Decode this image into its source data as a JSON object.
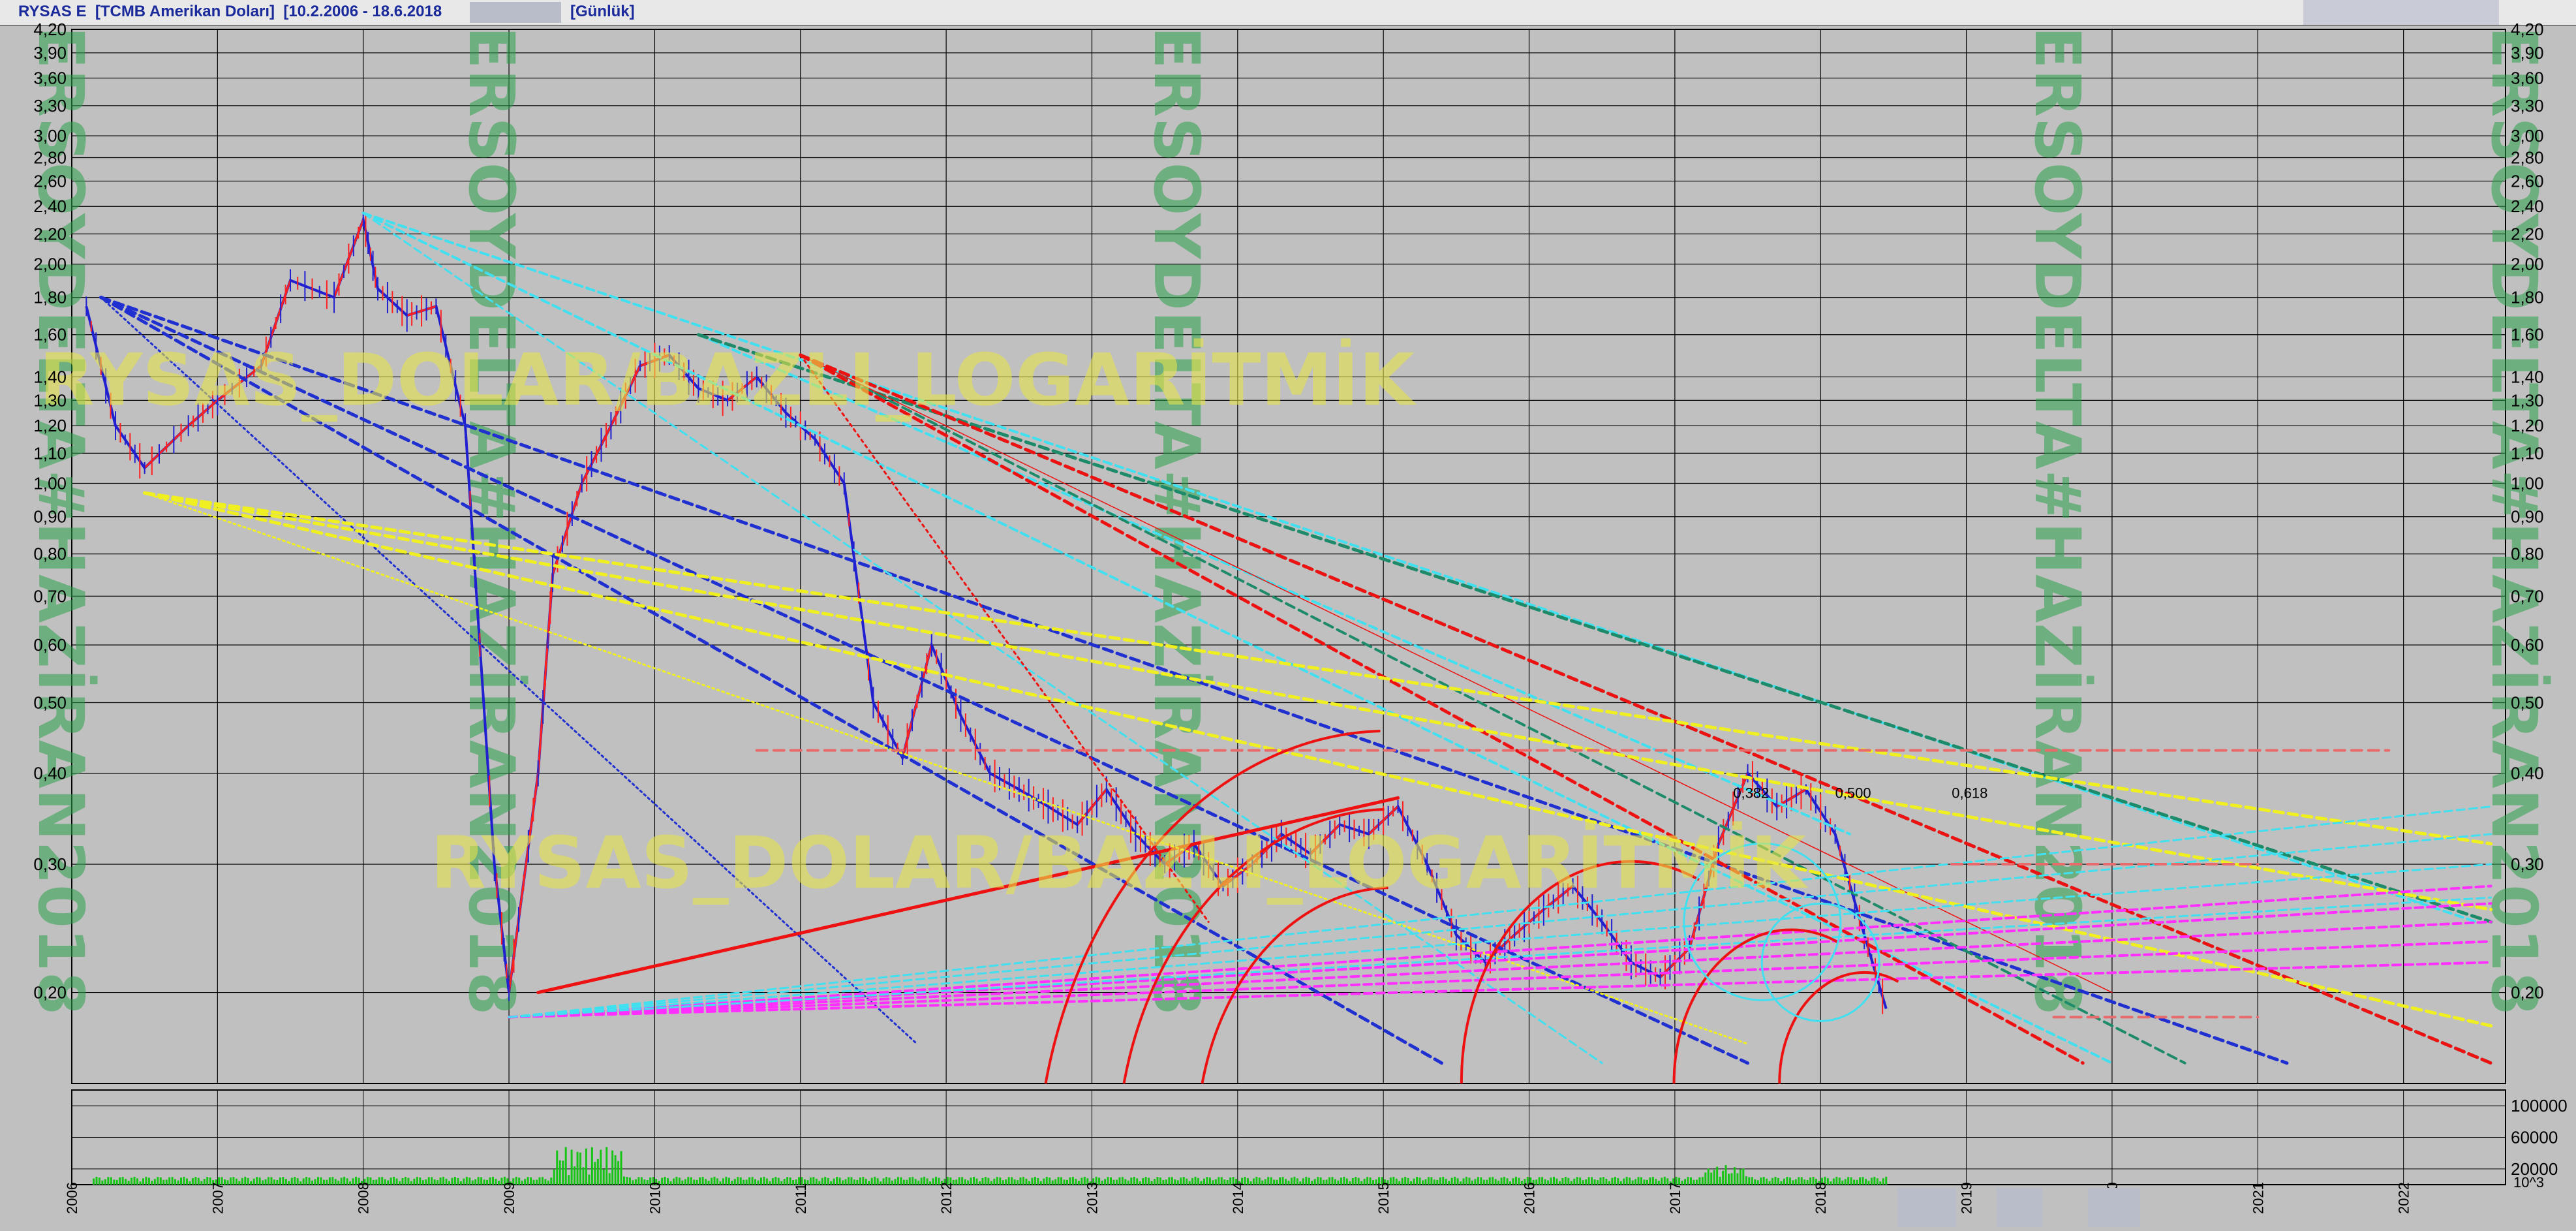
{
  "header": {
    "symbol": "RYSAS E",
    "currency": "[TCMB Amerikan Doları]",
    "range": "[10.2.2006 - 18.6.2018",
    "period": "[Günlük]"
  },
  "watermarks": {
    "vertical": [
      "ERSOYDELTA#HAZİRAN2018",
      "ERSOYDELTA#HAZİRAN2018",
      "ERSOYDELTA#HAZİRAN2018",
      "ERSOYDELTA#HAZİRAN2018",
      "ERSOYDELTA#HAZİRAN2018"
    ],
    "horizontal_top": "RYSAS_DOLAR/BAZLI_LOGARİTMİK",
    "horizontal_mid": "RYSAS_DOLAR/BAZLI_LOGARİTMİK"
  },
  "fib_labels": [
    "0,382",
    "0,500",
    "0,618"
  ],
  "volume_scale_note": "10^3",
  "colors": {
    "background": "#c0c0c0",
    "price_up": "#ff2020",
    "price_down": "#2020d0",
    "volume": "#16c416",
    "trend_blue": "#1f2fd0",
    "trend_cyan": "#40e0f0",
    "trend_yellow": "#f0f020",
    "trend_red": "#ee1111",
    "trend_teal": "#1d8a6a",
    "trend_magenta": "#ff30ff",
    "watermark": "#2aa04a",
    "watermark_h": "#e6e24a"
  },
  "chart_data": {
    "type": "line",
    "title": "RYSAS E [TCMB Amerikan Doları] [10.2.2006 - 18.6.2018 [Günlük]",
    "y_scale": "log",
    "ylim": [
      0.15,
      4.2
    ],
    "xlim": [
      2006.0,
      2022.7
    ],
    "price_y_ticks": [
      "4,20",
      "3,90",
      "3,60",
      "3,30",
      "3,00",
      "2,80",
      "2,60",
      "2,40",
      "2,20",
      "2,00",
      "1,80",
      "1,60",
      "1,40",
      "1,30",
      "1,20",
      "1,10",
      "1,00",
      "0,90",
      "0,80",
      "0,70",
      "0,60",
      "0,50",
      "0,40",
      "0,30",
      "0,20"
    ],
    "volume_y_ticks": [
      "100000",
      "60000",
      "20000"
    ],
    "x_tick_labels": [
      "2006",
      "2007",
      "2008",
      "2009",
      "2010",
      "2011",
      "2012",
      "2013",
      "2014",
      "2015",
      "2016",
      "2017",
      "2018",
      "2019",
      "2020",
      "2021",
      "2022"
    ],
    "grid": true,
    "series": [
      {
        "x": [
          2006.1,
          2006.3,
          2006.5,
          2006.8,
          2007.0,
          2007.3,
          2007.5,
          2007.8,
          2008.0,
          2008.1,
          2008.3,
          2008.5,
          2008.7,
          2008.9,
          2009.0,
          2009.2,
          2009.3,
          2009.5,
          2009.7,
          2009.9,
          2010.1,
          2010.3,
          2010.5,
          2010.7,
          2010.9,
          2011.1,
          2011.3,
          2011.5,
          2011.7,
          2011.9,
          2012.1,
          2012.3,
          2012.5,
          2012.7,
          2012.9,
          2013.1,
          2013.3,
          2013.5,
          2013.7,
          2013.9,
          2014.1,
          2014.3,
          2014.5,
          2014.7,
          2014.9,
          2015.1,
          2015.3,
          2015.5,
          2015.7,
          2015.9,
          2016.1,
          2016.3,
          2016.5,
          2016.7,
          2016.9,
          2017.1,
          2017.3,
          2017.5,
          2017.7,
          2017.9,
          2018.1,
          2018.3,
          2018.45
        ],
        "values": [
          1.75,
          1.2,
          1.05,
          1.2,
          1.3,
          1.45,
          1.9,
          1.8,
          2.3,
          1.85,
          1.7,
          1.75,
          1.2,
          0.3,
          0.2,
          0.4,
          0.75,
          1.0,
          1.2,
          1.45,
          1.5,
          1.35,
          1.3,
          1.4,
          1.25,
          1.15,
          1.0,
          0.5,
          0.42,
          0.6,
          0.48,
          0.4,
          0.38,
          0.36,
          0.34,
          0.38,
          0.33,
          0.3,
          0.32,
          0.28,
          0.3,
          0.33,
          0.31,
          0.34,
          0.33,
          0.36,
          0.3,
          0.24,
          0.22,
          0.24,
          0.26,
          0.28,
          0.25,
          0.22,
          0.21,
          0.23,
          0.32,
          0.4,
          0.36,
          0.38,
          0.33,
          0.24,
          0.19
        ]
      }
    ]
  }
}
